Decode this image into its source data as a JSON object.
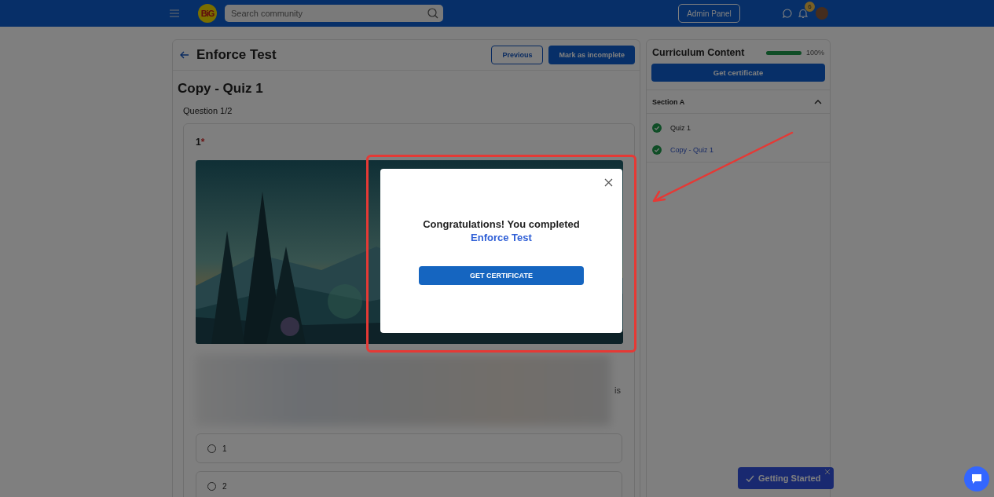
{
  "topbar": {
    "logo": "BiG",
    "search": {
      "placeholder": "Search community"
    },
    "admin_button": "Admin Panel",
    "notification_count": "6"
  },
  "lesson": {
    "title": "Enforce Test",
    "buttons": [
      {
        "label": "Previous",
        "kind": "outline"
      },
      {
        "label": "Mark as incomplete",
        "kind": "filled"
      }
    ],
    "quiz_title": "Copy - Quiz 1",
    "progress": "Question 1/2",
    "question": {
      "number": "1",
      "required_mark": "*",
      "blurred_text_end": "is",
      "options": [
        {
          "label": "1",
          "selected": false
        },
        {
          "label": "2",
          "selected": false
        }
      ]
    }
  },
  "sidebar": {
    "title": "Curriculum Content",
    "progress": {
      "level": 1,
      "reading": "100%"
    },
    "certificate_button": "Get certificate",
    "sections": [
      {
        "title": "Section A",
        "expanded": true,
        "items": [
          {
            "label": "Quiz 1",
            "completed": true,
            "selected": false
          },
          {
            "label": "Copy - Quiz 1",
            "completed": true,
            "selected": true
          }
        ]
      }
    ]
  },
  "dialog": {
    "message": "Congratulations! You completed",
    "course": "Enforce Test",
    "button": "GET CERTIFICATE"
  },
  "getting_started": {
    "label": "Getting Started"
  }
}
